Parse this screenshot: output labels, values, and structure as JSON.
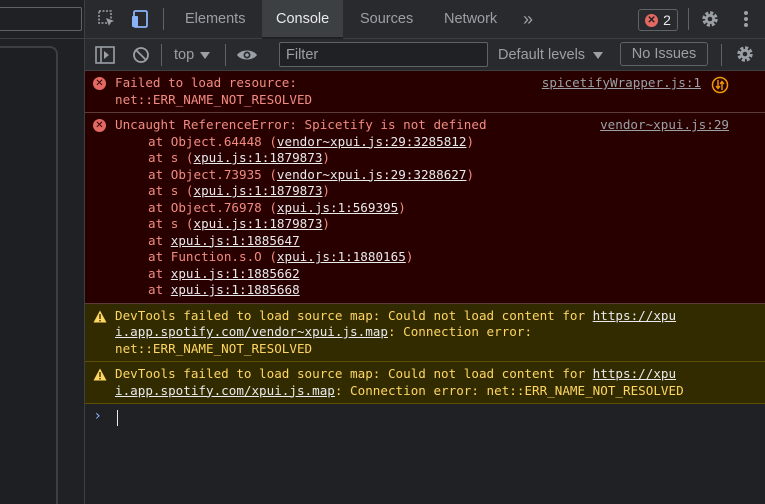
{
  "tabs": {
    "elements": "Elements",
    "console": "Console",
    "sources": "Sources",
    "network": "Network",
    "more": "»"
  },
  "error_count": "2",
  "toolbar": {
    "context": "top",
    "filter_placeholder": "Filter",
    "levels": "Default levels",
    "issues": "No Issues"
  },
  "messages": [
    {
      "type": "error",
      "line1": "Failed to load resource:",
      "line2": "net::ERR_NAME_NOT_RESOLVED",
      "source": "spicetifyWrapper.js:1"
    },
    {
      "type": "error",
      "line1": "Uncaught ReferenceError: Spicetify is not defined",
      "source": "vendor~xpui.js:29",
      "trace": [
        {
          "prefix": "at Object.64448 (",
          "link": "vendor~xpui.js:29:3285812",
          "suffix": ")"
        },
        {
          "prefix": "at s (",
          "link": "xpui.js:1:1879873",
          "suffix": ")"
        },
        {
          "prefix": "at Object.73935 (",
          "link": "vendor~xpui.js:29:3288627",
          "suffix": ")"
        },
        {
          "prefix": "at s (",
          "link": "xpui.js:1:1879873",
          "suffix": ")"
        },
        {
          "prefix": "at Object.76978 (",
          "link": "xpui.js:1:569395",
          "suffix": ")"
        },
        {
          "prefix": "at s (",
          "link": "xpui.js:1:1879873",
          "suffix": ")"
        },
        {
          "prefix": "at ",
          "link": "xpui.js:1:1885647",
          "suffix": ""
        },
        {
          "prefix": "at Function.s.O (",
          "link": "xpui.js:1:1880165",
          "suffix": ")"
        },
        {
          "prefix": "at ",
          "link": "xpui.js:1:1885662",
          "suffix": ""
        },
        {
          "prefix": "at ",
          "link": "xpui.js:1:1885668",
          "suffix": ""
        }
      ]
    },
    {
      "type": "warn",
      "text_before": "DevTools failed to load source map: Could not load content for ",
      "link_a": "https://xpu",
      "link_b": "i.app.spotify.com/vendor~xpui.js.map",
      "text_after": ": Connection error:",
      "line3": "net::ERR_NAME_NOT_RESOLVED"
    },
    {
      "type": "warn",
      "text_before": "DevTools failed to load source map: Could not load content for ",
      "link_a": "https://xpu",
      "link_b": "i.app.spotify.com/xpui.js.map",
      "text_after": ": Connection error: net::ERR_NAME_NOT_RESOLVED"
    }
  ],
  "prompt_symbol": "›",
  "colors": {
    "error_bg": "#290000",
    "error_text": "#f28b82",
    "warn_bg": "#332b00",
    "warn_text": "#fdd663",
    "accent": "#8ab4f8"
  }
}
